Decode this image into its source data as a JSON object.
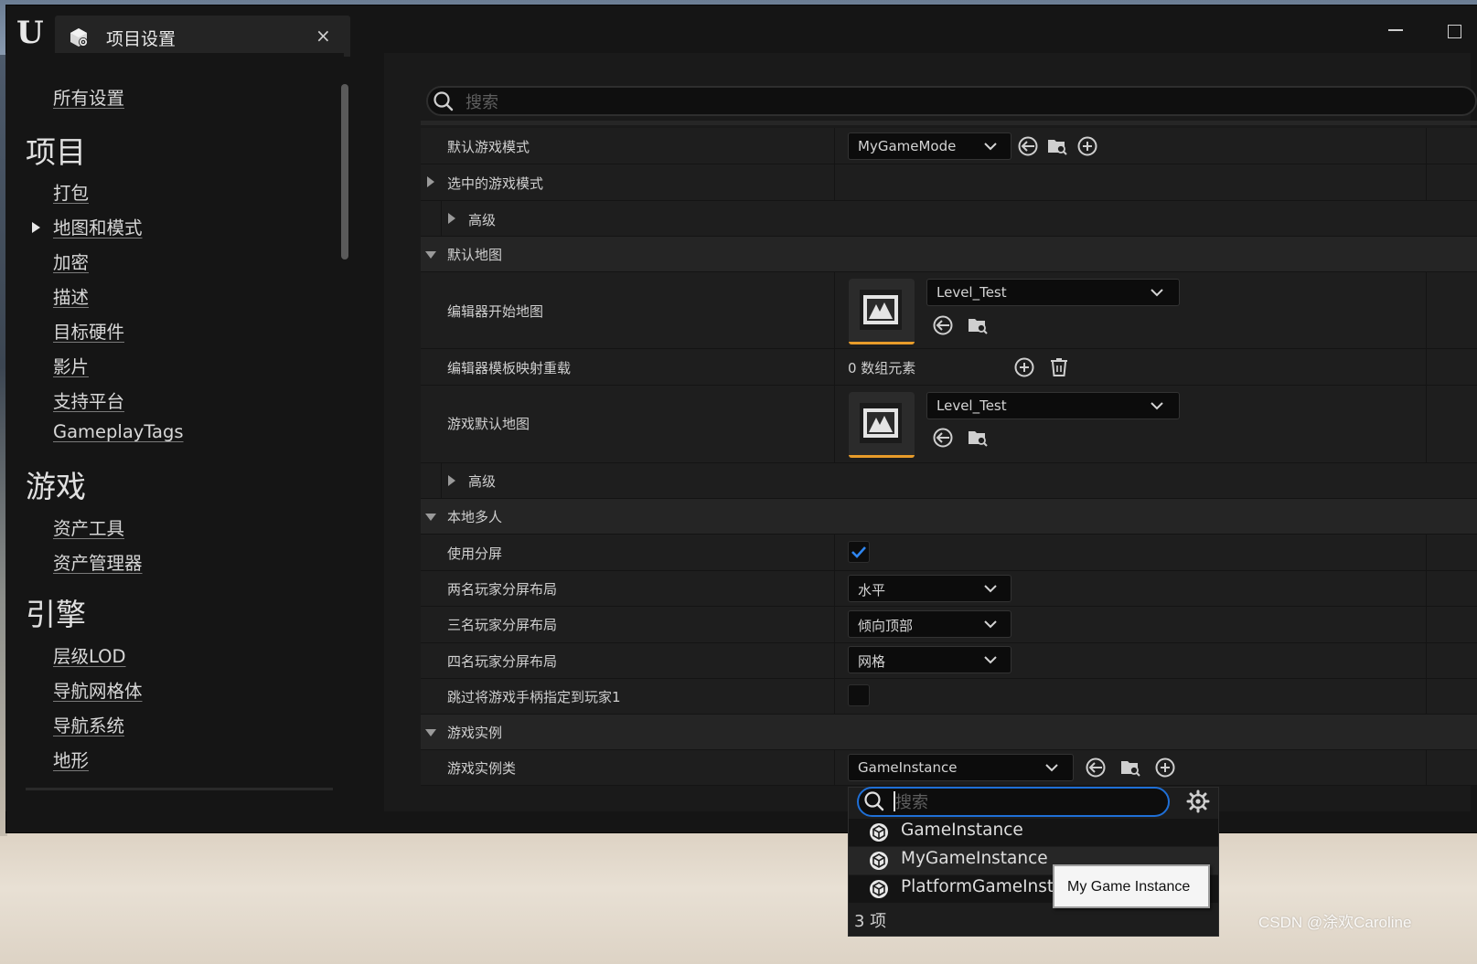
{
  "window": {
    "tab_title": "项目设置",
    "close_glyph": "×"
  },
  "sidebar": {
    "all_settings": "所有设置",
    "sections": [
      {
        "heading": "项目",
        "items": [
          "打包",
          "地图和模式",
          "加密",
          "描述",
          "目标硬件",
          "影片",
          "支持平台",
          "GameplayTags"
        ]
      },
      {
        "heading": "游戏",
        "items": [
          "资产工具",
          "资产管理器"
        ]
      },
      {
        "heading": "引擎",
        "items": [
          "层级LOD",
          "导航网格体",
          "导航系统",
          "地形"
        ]
      }
    ],
    "selected_item": "地图和模式"
  },
  "search": {
    "placeholder": "搜索"
  },
  "settings": {
    "default_game_mode": {
      "label": "默认游戏模式",
      "value": "MyGameMode"
    },
    "selected_game_mode": {
      "label": "选中的游戏模式"
    },
    "advanced_1": {
      "label": "高级"
    },
    "default_maps": {
      "label": "默认地图"
    },
    "editor_startup_map": {
      "label": "编辑器开始地图",
      "value": "Level_Test"
    },
    "editor_template_map_overrides": {
      "label": "编辑器模板映射重载",
      "value": "0 数组元素"
    },
    "game_default_map": {
      "label": "游戏默认地图",
      "value": "Level_Test"
    },
    "advanced_2": {
      "label": "高级"
    },
    "local_multiplayer": {
      "label": "本地多人"
    },
    "use_splitscreen": {
      "label": "使用分屏",
      "checked": true
    },
    "two_player_layout": {
      "label": "两名玩家分屏布局",
      "value": "水平"
    },
    "three_player_layout": {
      "label": "三名玩家分屏布局",
      "value": "倾向顶部"
    },
    "four_player_layout": {
      "label": "四名玩家分屏布局",
      "value": "网格"
    },
    "skip_gamepad_assign": {
      "label": "跳过将游戏手柄指定到玩家1",
      "checked": false
    },
    "game_instance": {
      "label": "游戏实例"
    },
    "game_instance_class": {
      "label": "游戏实例类",
      "value": "GameInstance"
    }
  },
  "dropdown_popup": {
    "search_placeholder": "搜索",
    "items": [
      "GameInstance",
      "MyGameInstance",
      "PlatformGameInsta"
    ],
    "count_text": "3 项",
    "tooltip": "My Game Instance"
  },
  "watermark": "CSDN @涂欢Caroline",
  "colors": {
    "accent_blue": "#1f6fd6",
    "thumbnail_orange": "#e89c2a"
  }
}
